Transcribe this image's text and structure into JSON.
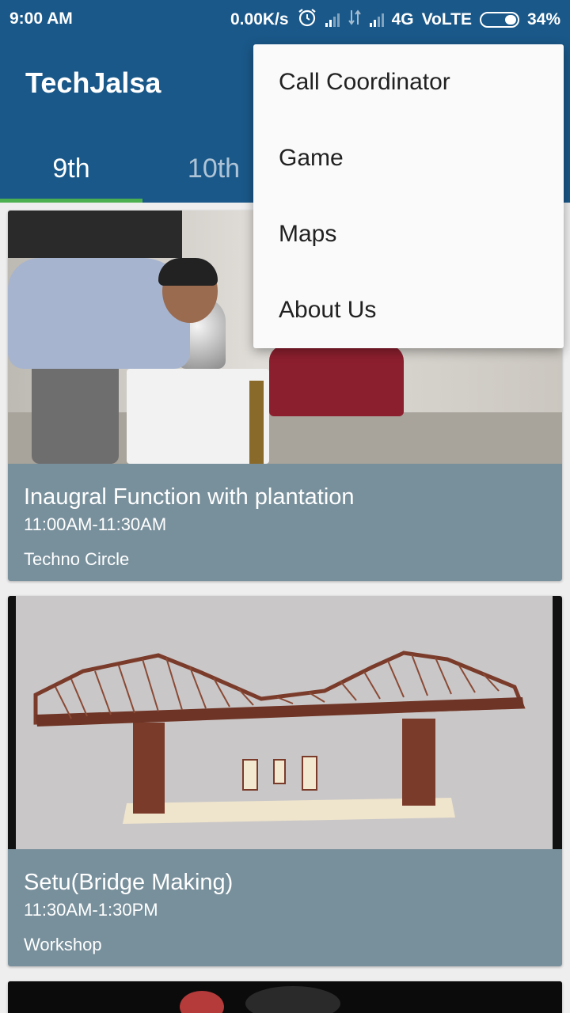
{
  "status_bar": {
    "time": "9:00 AM",
    "net_speed": "0.00K/s",
    "alarm_icon": "alarm-icon",
    "network": "4G",
    "volte": "VoLTE",
    "battery": "34%",
    "battery_level": 0.34
  },
  "app": {
    "title": "TechJalsa",
    "tabs": [
      {
        "label": "9th",
        "active": true
      },
      {
        "label": "10th",
        "active": false
      }
    ],
    "accent_color": "#1a5889",
    "indicator_color": "#4caf50"
  },
  "overflow_menu": {
    "items": [
      {
        "label": "Call Coordinator"
      },
      {
        "label": "Game"
      },
      {
        "label": "Maps"
      },
      {
        "label": "About Us"
      }
    ]
  },
  "events": [
    {
      "title": "Inaugral Function with plantation",
      "time": "11:00AM-11:30AM",
      "venue": "Techno Circle"
    },
    {
      "title": "Setu(Bridge Making)",
      "time": "11:30AM-1:30PM",
      "venue": "Workshop"
    }
  ]
}
